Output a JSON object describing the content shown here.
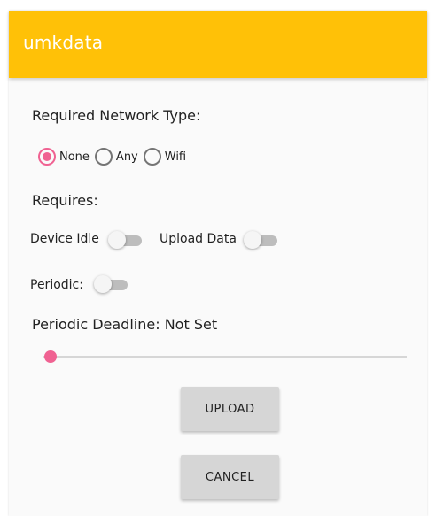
{
  "app_bar": {
    "title": "umkdata",
    "color": "#ffc107"
  },
  "network": {
    "label": "Required Network Type:",
    "options": [
      {
        "label": "None",
        "checked": true
      },
      {
        "label": "Any",
        "checked": false
      },
      {
        "label": "Wifi",
        "checked": false
      }
    ]
  },
  "requires": {
    "label": "Requires:",
    "device_idle": {
      "label": "Device Idle",
      "on": false
    },
    "upload_data": {
      "label": "Upload Data",
      "on": false
    }
  },
  "periodic": {
    "label": "Periodic:",
    "on": false
  },
  "deadline": {
    "label": "Periodic Deadline: Not Set",
    "slider_value": 0
  },
  "buttons": {
    "upload": "UPLOAD",
    "cancel": "CANCEL"
  },
  "colors": {
    "accent": "#f06292",
    "switch_off_track": "#bdbdbd",
    "button_bg": "#d6d6d6"
  }
}
